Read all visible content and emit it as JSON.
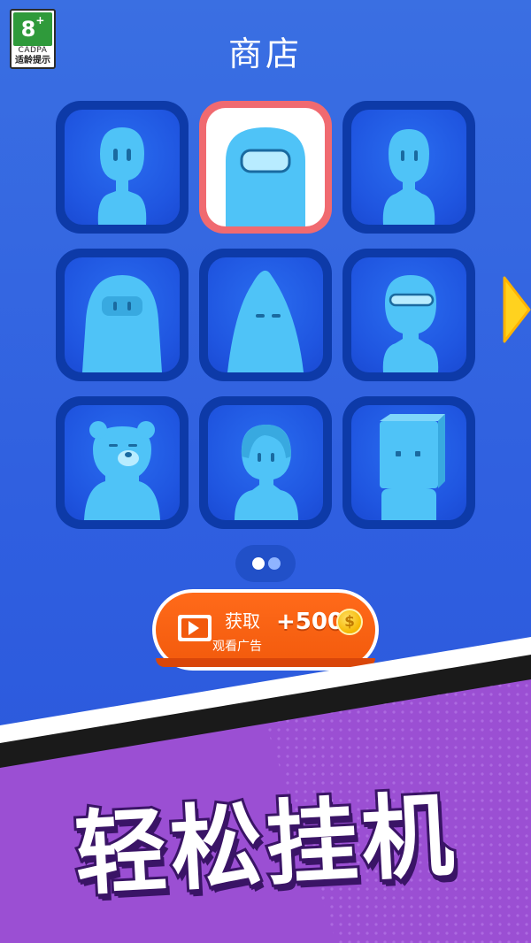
{
  "age_rating": {
    "label": "8",
    "plus": "+",
    "org": "CADPA",
    "tip": "适龄提示"
  },
  "header": {
    "title": "商店"
  },
  "shop": {
    "items": [
      {
        "name": "bean-character"
      },
      {
        "name": "crewmate-character"
      },
      {
        "name": "bald-character"
      },
      {
        "name": "hooded-character"
      },
      {
        "name": "cone-character"
      },
      {
        "name": "visor-character"
      },
      {
        "name": "bear-character"
      },
      {
        "name": "bob-hair-character"
      },
      {
        "name": "cube-head-character"
      }
    ],
    "selected_index": 1,
    "next_icon": "triangle-right-icon"
  },
  "pager": {
    "current": 1,
    "total": 2
  },
  "ad_button": {
    "action": "获取",
    "subtitle": "观看广告",
    "reward": "+500",
    "coin_symbol": "$",
    "icon": "video-play-icon"
  },
  "banner": {
    "slogan": "轻松挂机"
  },
  "colors": {
    "background": "#3a6fe2",
    "tile": "#0d3aa8",
    "selected_border": "#f06a70",
    "ad_button": "#f25a0c",
    "banner": "#9b4fd3",
    "coin": "#f5b700"
  }
}
